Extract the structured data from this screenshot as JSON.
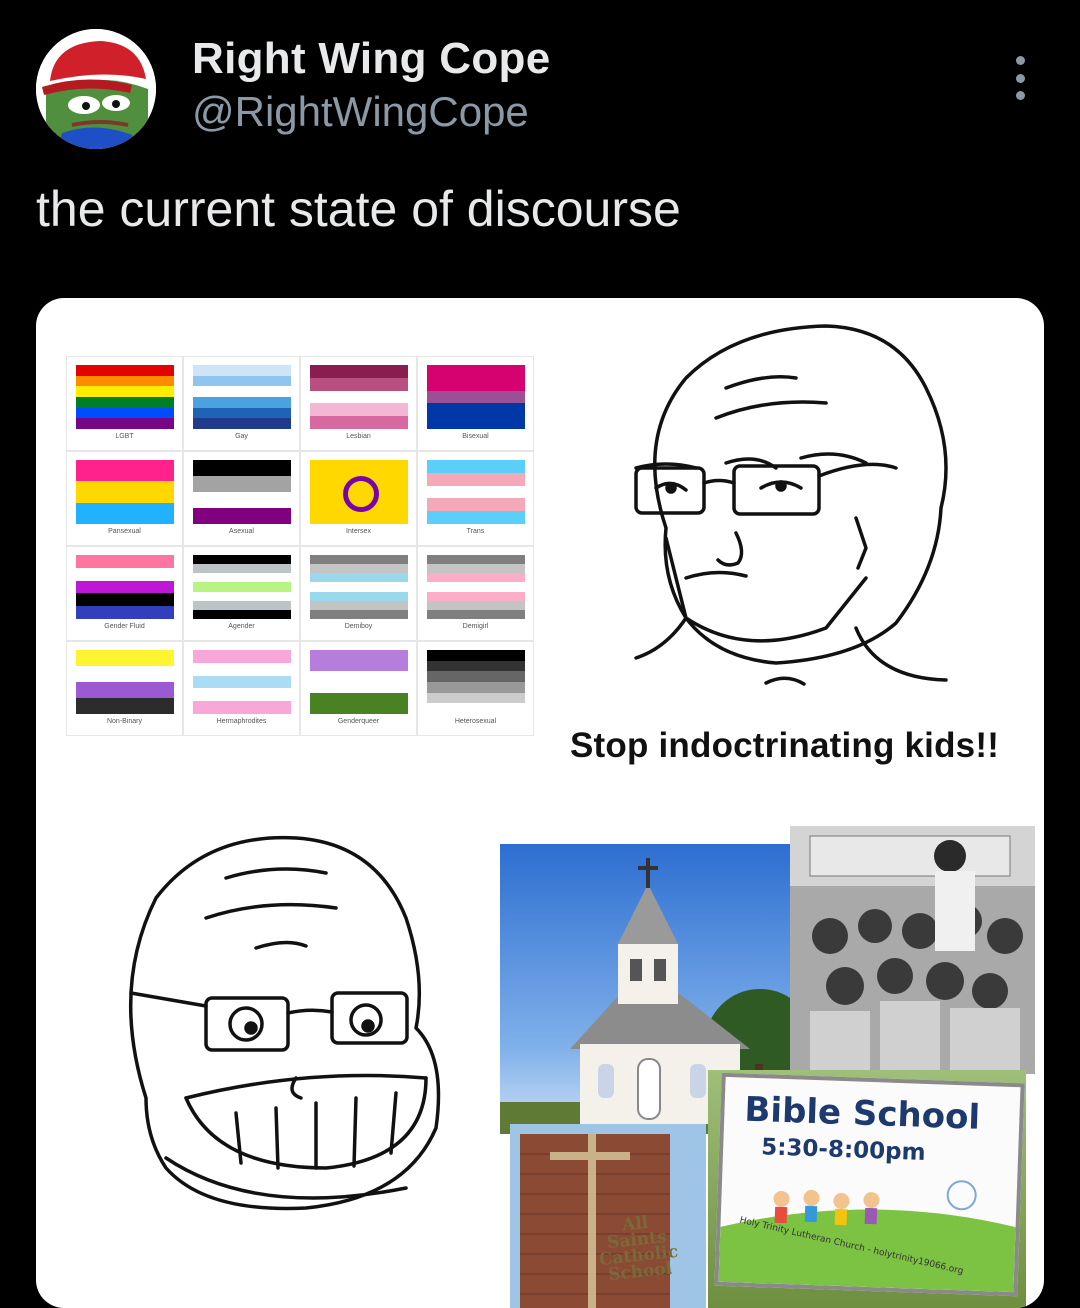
{
  "tweet": {
    "display_name": "Right Wing Cope",
    "handle": "@RightWingCope",
    "text": "the current state of discourse",
    "more_icon": "more-options-icon"
  },
  "meme": {
    "caption": "Stop indoctrinating kids!!",
    "flags": [
      {
        "label": "LGBT",
        "stripes": [
          "#e40303",
          "#ff8c00",
          "#ffed00",
          "#008026",
          "#004dff",
          "#750787"
        ]
      },
      {
        "label": "Gay",
        "stripes": [
          "#cfe4f7",
          "#8fc5ef",
          "#ffffff",
          "#4aa3df",
          "#1e63b6",
          "#203a8c"
        ]
      },
      {
        "label": "Lesbian",
        "stripes": [
          "#8a1c4f",
          "#b84f80",
          "#ffffff",
          "#f4b7d3",
          "#d66aa0"
        ]
      },
      {
        "label": "Bisexual",
        "stripes": [
          "#d60270",
          "#d60270",
          "#9b4f96",
          "#0038a8",
          "#0038a8"
        ]
      },
      {
        "label": "Pansexual",
        "stripes": [
          "#ff218c",
          "#ffd800",
          "#21b1ff"
        ]
      },
      {
        "label": "Asexual",
        "stripes": [
          "#000000",
          "#a3a3a3",
          "#ffffff",
          "#800080"
        ]
      },
      {
        "label": "Intersex",
        "stripes": [
          "#ffd800"
        ]
      },
      {
        "label": "Trans",
        "stripes": [
          "#5bcefa",
          "#f5a9b8",
          "#ffffff",
          "#f5a9b8",
          "#5bcefa"
        ]
      },
      {
        "label": "Gender Fluid",
        "stripes": [
          "#ff75a2",
          "#ffffff",
          "#be18d6",
          "#000000",
          "#333ebd"
        ]
      },
      {
        "label": "Agender",
        "stripes": [
          "#000000",
          "#bcc4c7",
          "#ffffff",
          "#b8f483",
          "#ffffff",
          "#bcc4c7",
          "#000000"
        ]
      },
      {
        "label": "Demiboy",
        "stripes": [
          "#7f7f7f",
          "#c4c4c4",
          "#9ad9eb",
          "#ffffff",
          "#9ad9eb",
          "#c4c4c4",
          "#7f7f7f"
        ]
      },
      {
        "label": "Demigirl",
        "stripes": [
          "#7f7f7f",
          "#c4c4c4",
          "#fcadc8",
          "#ffffff",
          "#fcadc8",
          "#c4c4c4",
          "#7f7f7f"
        ]
      },
      {
        "label": "Non-Binary",
        "stripes": [
          "#fff430",
          "#ffffff",
          "#9c59d1",
          "#2c2c2c"
        ]
      },
      {
        "label": "Hermaphrodites",
        "stripes": [
          "#f7a8d8",
          "#ffffff",
          "#aadcf5",
          "#ffffff",
          "#f7a8d8"
        ]
      },
      {
        "label": "Genderqueer",
        "stripes": [
          "#b57edc",
          "#ffffff",
          "#4a8123"
        ]
      },
      {
        "label": "Heterosexual",
        "stripes": [
          "#000000",
          "#333333",
          "#666666",
          "#999999",
          "#cccccc",
          "#ffffff"
        ]
      }
    ],
    "bible_sign": {
      "title": "Bible School",
      "time": "5:30-8:00pm",
      "footer": "Holy Trinity Lutheran Church - holytrinity19066.org"
    },
    "brick_sign": [
      "All",
      "Saints",
      "Catholic",
      "School"
    ]
  }
}
